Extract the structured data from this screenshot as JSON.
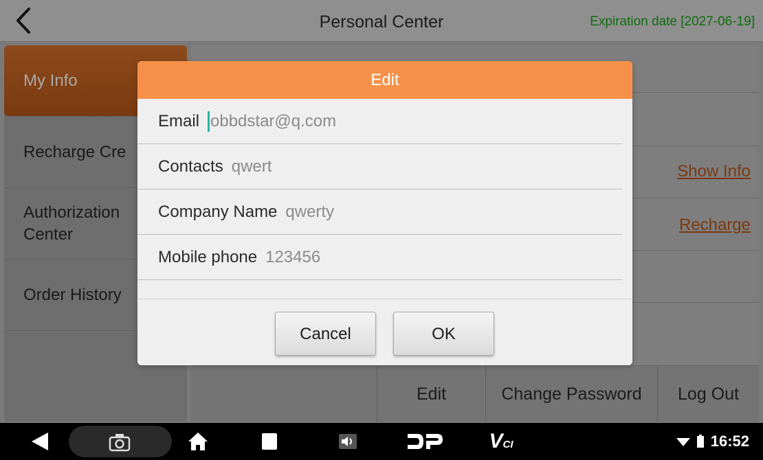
{
  "header": {
    "title": "Personal Center",
    "expiry": "Expiration date [2027-06-19]"
  },
  "sidebar": {
    "items": [
      {
        "label": "My Info"
      },
      {
        "label": "Recharge Cre"
      },
      {
        "label": "Authorization Center"
      },
      {
        "label": "Order History"
      }
    ]
  },
  "content": {
    "show_info_link": "Show Info",
    "recharge_link": "Recharge",
    "bottom_actions": {
      "edit": "Edit",
      "change_password": "Change Password",
      "log_out": "Log Out"
    }
  },
  "dialog": {
    "title": "Edit",
    "fields": [
      {
        "label": "Email",
        "value": "obbdstar@q.com"
      },
      {
        "label": "Contacts",
        "value": "qwert"
      },
      {
        "label": "Company Name",
        "value": "qwerty"
      },
      {
        "label": "Mobile phone",
        "value": "123456"
      }
    ],
    "cancel_label": "Cancel",
    "ok_label": "OK"
  },
  "status_bar": {
    "time": "16:52",
    "vci_label": "V"
  },
  "colors": {
    "dialog_header": "#f7914a",
    "expiry_text": "#0f6d0f",
    "link": "#7a3a10"
  }
}
